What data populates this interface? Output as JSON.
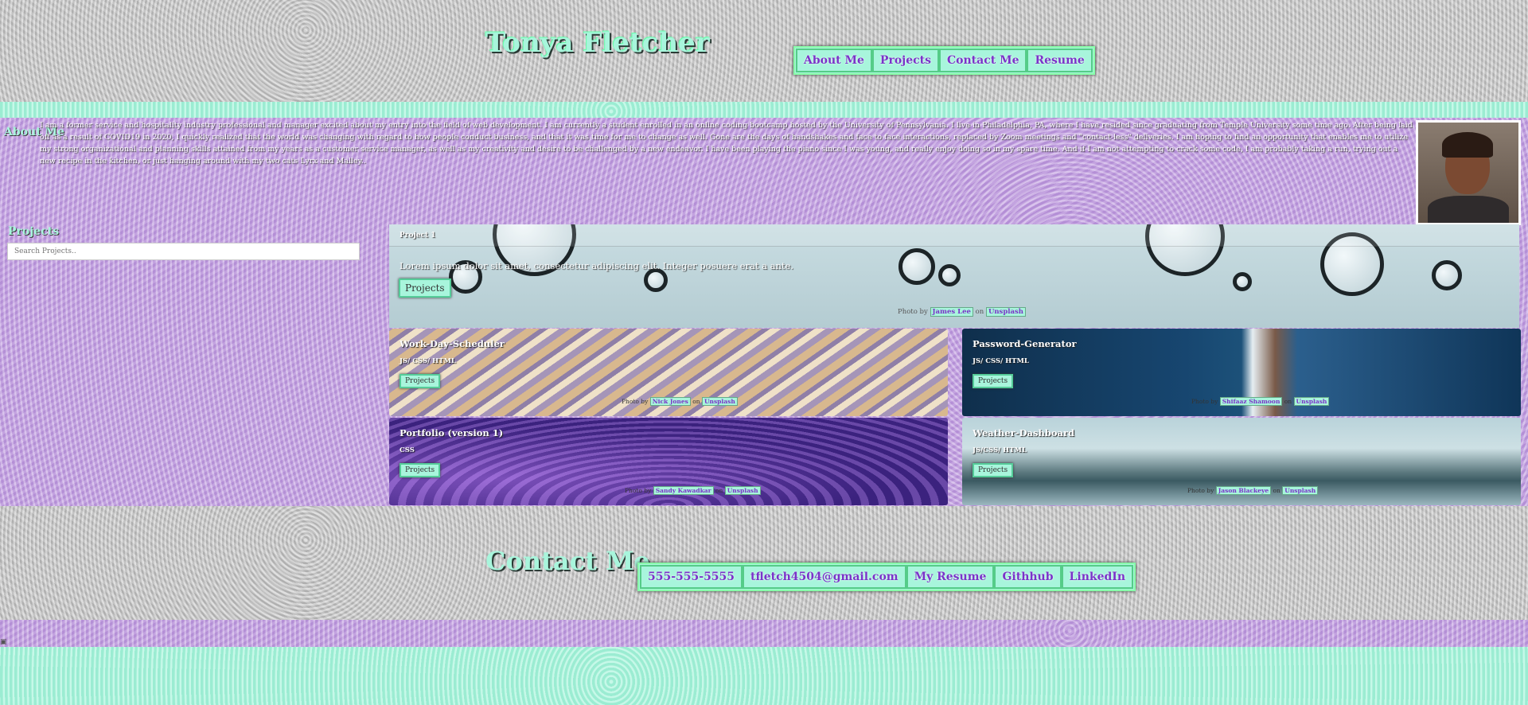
{
  "header": {
    "title": "Tonya Fletcher",
    "nav": [
      "About Me",
      "Projects",
      "Contact Me",
      "Resume"
    ]
  },
  "about": {
    "heading": "About Me",
    "text": "I am a former service and hospitality industry professional and manager excited about my entry into the field of web development. I am currently a student enrolled in an online coding bootcamp hosted by the University of Pennsylvania. I live in Philadelphia, PA, where I have resided since graduating from Temple University some time ago. After being laid off as a result of COVID19 in 2020, I quickly realized that the world was changing with regard to how people conduct business, and that it was time for me to change as well. Gone are the days of handshakes and face to face interactions, replaced by Zoom meetings and \"contact-less\" deliveries. I am hoping to find an opportunity that enables me to utilize my strong organizational and planning skills attained from my years as a customer service manager, as well as my creativity and desire to be challenged by a new endeavor. I have been playing the piano since I was young, and really enjoy doing so in my spare time. And if I am not attempting to crack some code, I am probably taking a run, trying out a new recipe in the kitchen, or just hanging around with my two cats Lyrx and Malley.."
  },
  "projects": {
    "heading": "Projects",
    "search_placeholder": "Search Projects.."
  },
  "featured": {
    "header": "Project 1",
    "text": "Lorem ipsum dolor sit amet, consectetur adipiscing elit. Integer posuere erat a ante.",
    "button": "Projects",
    "credit_prefix": "Photo by",
    "credit_author": "James Lee",
    "credit_on": "on",
    "credit_site": "Unsplash"
  },
  "cards": [
    {
      "title": "Work-Day-Scheduler",
      "tech": "JS/ CSS/ HTML",
      "button": "Projects",
      "credit_prefix": "Photo by",
      "credit_author": "Nick Jones",
      "credit_on": "on",
      "credit_site": "Unsplash"
    },
    {
      "title": "Password-Generator",
      "tech": "JS/ CSS/ HTML",
      "button": "Projects",
      "credit_prefix": "Photo by",
      "credit_author": "Shifaaz Shamoon",
      "credit_on": "on",
      "credit_site": "Unsplash"
    },
    {
      "title": "Portfolio (version 1)",
      "tech": "CSS",
      "button": "Projects",
      "credit_prefix": "Photo by",
      "credit_author": "Sandy Kawadkar",
      "credit_on": "on",
      "credit_site": "Unsplash"
    },
    {
      "title": "Weather-Dashboard",
      "tech": "JS/CSS/ HTML",
      "button": "Projects",
      "credit_prefix": "Photo by",
      "credit_author": "Jason Blackeye",
      "credit_on": "on",
      "credit_site": "Unsplash"
    }
  ],
  "contact": {
    "title": "Contact Me",
    "links": [
      "555-555-5555",
      "tfletch4504@gmail.com",
      "My Resume",
      "Githhub",
      "LinkedIn"
    ]
  },
  "colors": {
    "mint": "#a8f5dc",
    "purple": "#c5a4e3",
    "gray": "#c4c4c4",
    "link_purple": "#7a33c9"
  },
  "icons": [
    "broken-image-icon"
  ]
}
